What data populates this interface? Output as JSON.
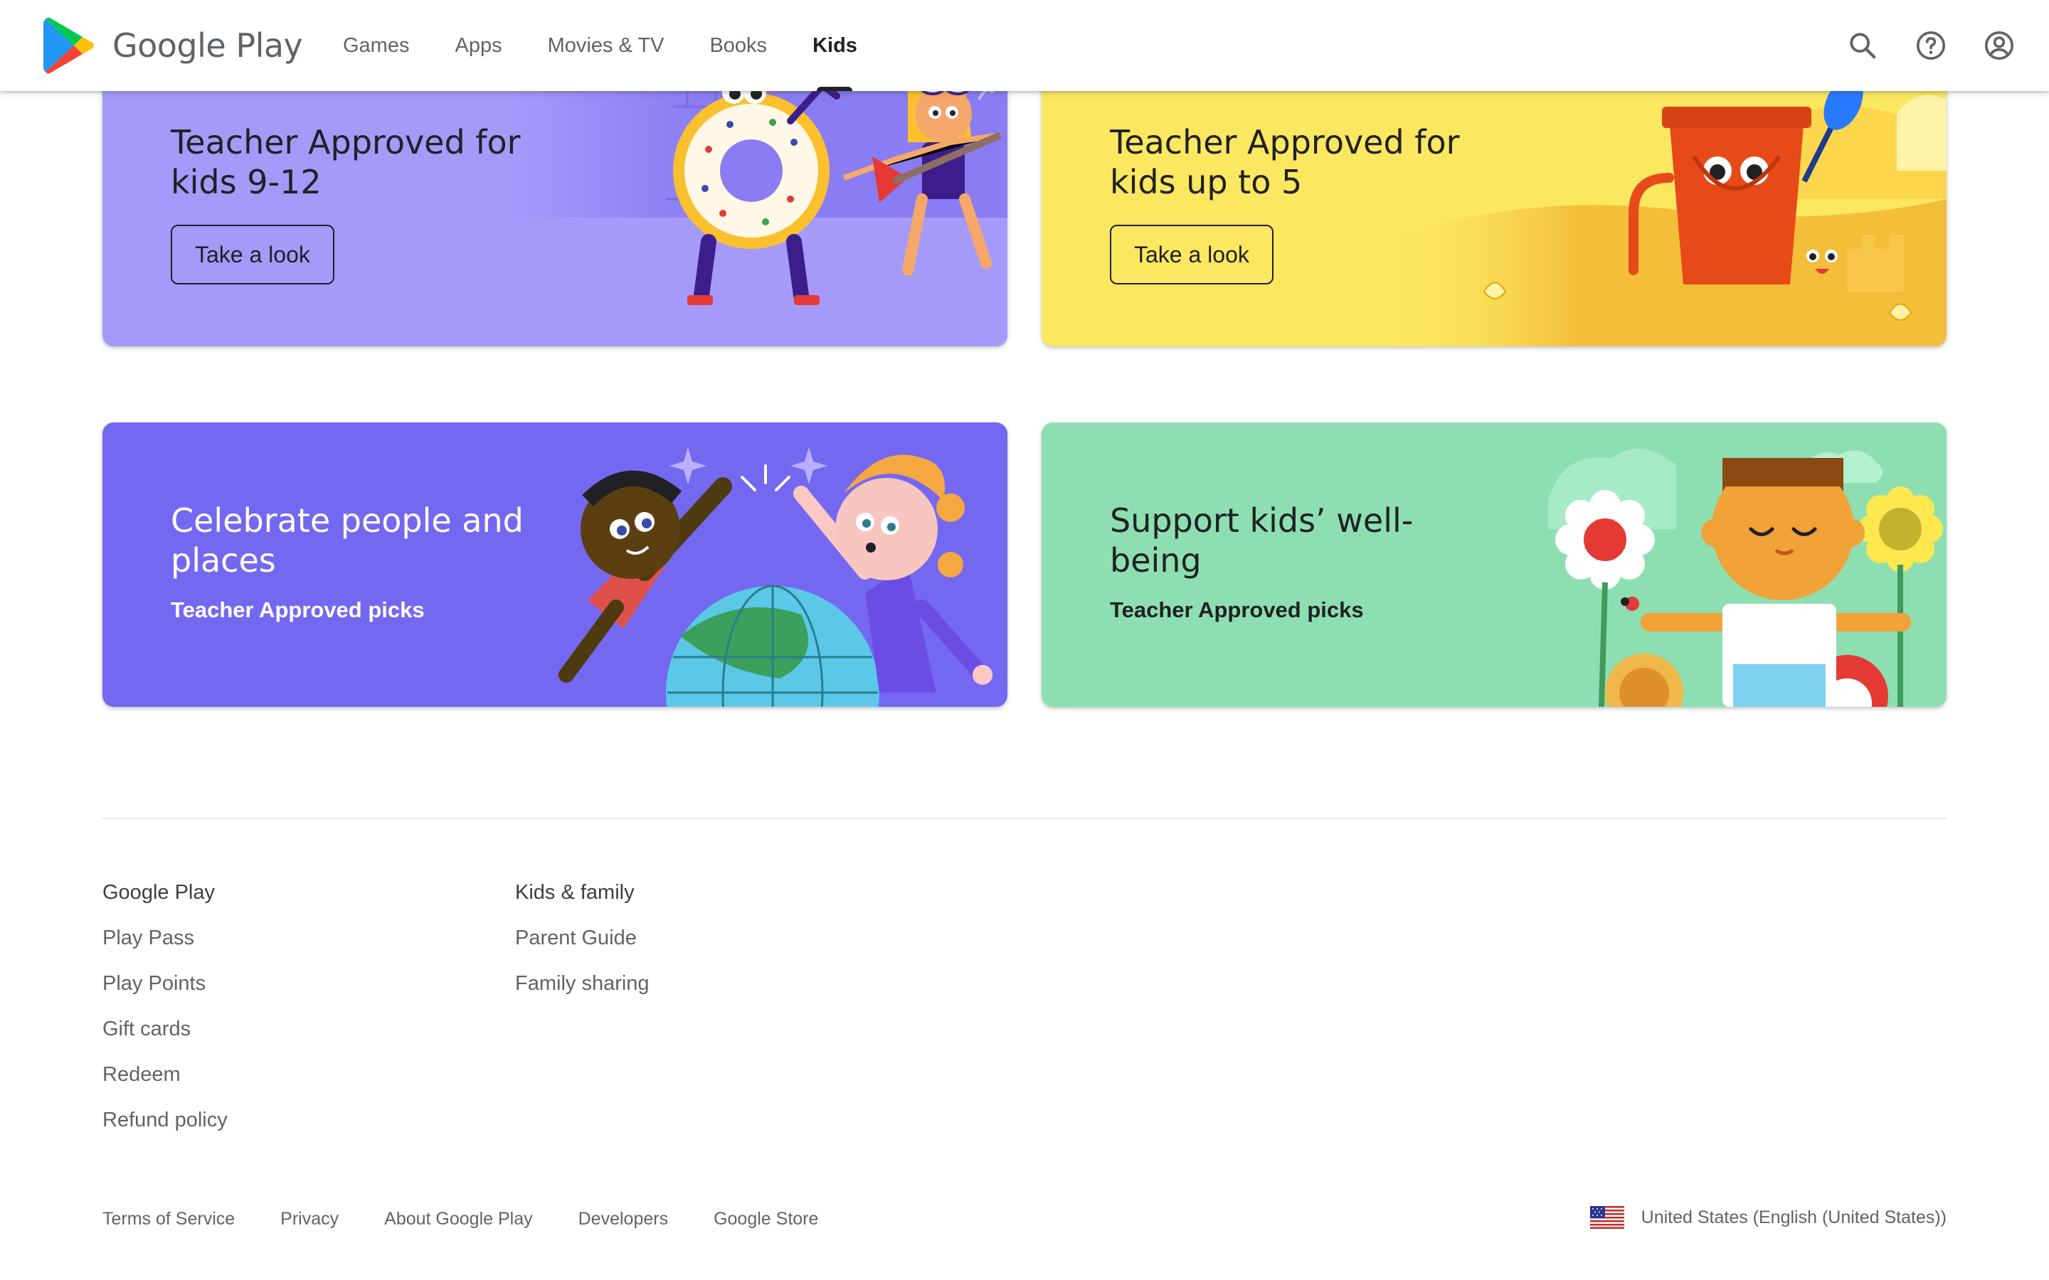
{
  "header": {
    "brand": "Google Play",
    "tabs": [
      {
        "label": "Games"
      },
      {
        "label": "Apps"
      },
      {
        "label": "Movies & TV"
      },
      {
        "label": "Books"
      },
      {
        "label": "Kids"
      }
    ],
    "active_tab": "Kids",
    "actions": [
      "search-icon",
      "help-icon",
      "account-icon"
    ]
  },
  "cards": [
    {
      "title": "Teacher Approved for kids 9-12",
      "button": "Take a look",
      "bg": "#a59afa"
    },
    {
      "title": "Teacher Approved for kids up to 5",
      "button": "Take a look",
      "bg": "#fce761"
    },
    {
      "title": "Celebrate people and places",
      "subtitle": "Teacher Approved picks",
      "bg": "#7568f0"
    },
    {
      "title": "Support kids’ well-being",
      "subtitle": "Teacher Approved picks",
      "bg": "#8ddfb2"
    }
  ],
  "footer": {
    "columns": [
      {
        "heading": "Google Play",
        "links": [
          "Play Pass",
          "Play Points",
          "Gift cards",
          "Redeem",
          "Refund policy"
        ]
      },
      {
        "heading": "Kids & family",
        "links": [
          "Parent Guide",
          "Family sharing"
        ]
      }
    ],
    "bottom_links": [
      "Terms of Service",
      "Privacy",
      "About Google Play",
      "Developers",
      "Google Store"
    ],
    "locale": "United States (English (United States))"
  },
  "colors": {
    "active_tab": "#202124",
    "text_secondary": "#5f6368"
  }
}
